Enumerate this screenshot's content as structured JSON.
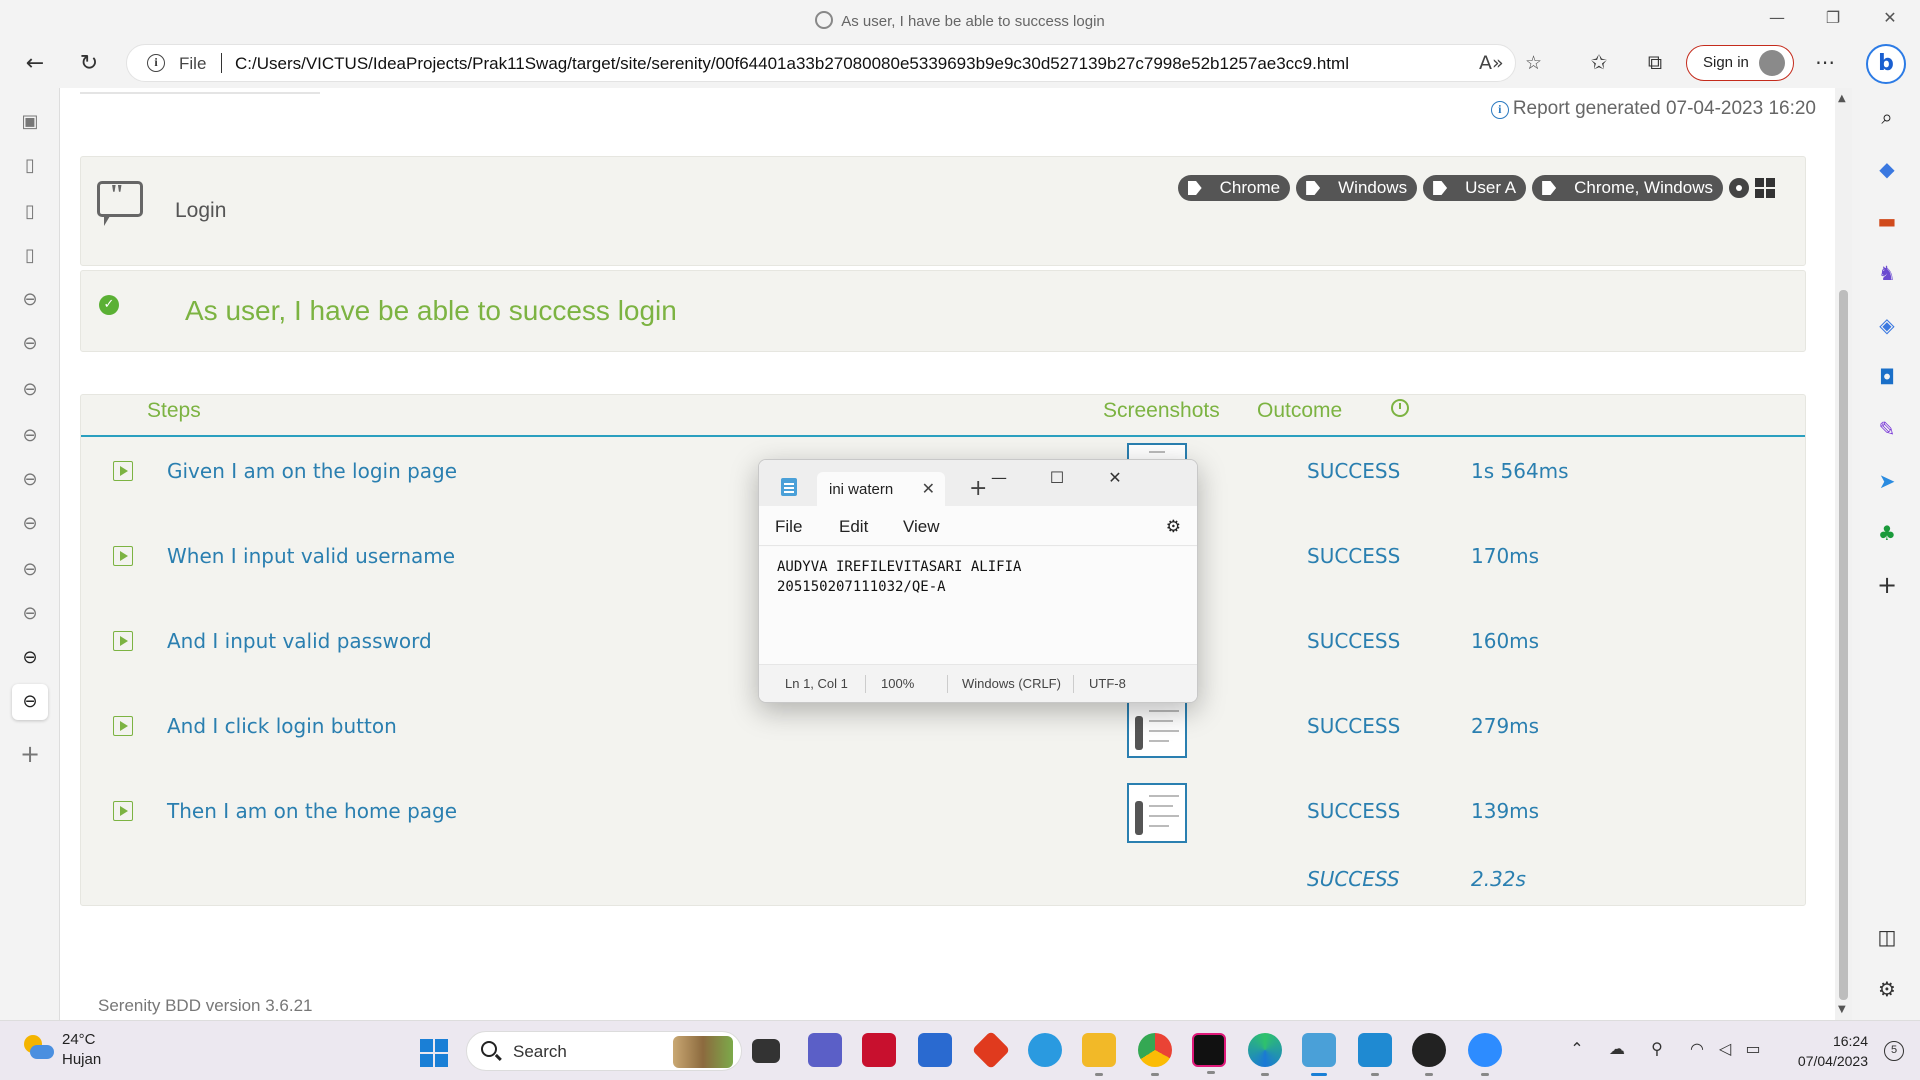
{
  "window": {
    "title": "As user, I have be able to success login"
  },
  "browser": {
    "address_scheme": "File",
    "url": "C:/Users/VICTUS/IdeaProjects/Prak11Swag/target/site/serenity/00f64401a33b27080080e5339693b9e9c30d527139b27c7998e52b1257ae3cc9.html",
    "sign_in_label": "Sign in"
  },
  "report": {
    "generated_label": "Report generated 07-04-2023 16:20",
    "feature_title": "Login",
    "tags": [
      "Chrome",
      "Windows",
      "User A",
      "Chrome, Windows"
    ],
    "scenario_title": "As user, I have be able to success login",
    "columns": {
      "steps": "Steps",
      "screenshots": "Screenshots",
      "outcome": "Outcome"
    },
    "steps": [
      {
        "text": "Given I am on the login page",
        "outcome": "SUCCESS",
        "duration": "1s 564ms"
      },
      {
        "text": "When I input valid username",
        "outcome": "SUCCESS",
        "duration": "170ms"
      },
      {
        "text": "And I input valid password",
        "outcome": "SUCCESS",
        "duration": "160ms"
      },
      {
        "text": "And I click login button",
        "outcome": "SUCCESS",
        "duration": "279ms"
      },
      {
        "text": "Then I am on the home page",
        "outcome": "SUCCESS",
        "duration": "139ms"
      }
    ],
    "total": {
      "outcome": "SUCCESS",
      "duration": "2.32s"
    },
    "footer": "Serenity BDD version 3.6.21"
  },
  "notepad": {
    "tab_title": "ini watern",
    "menu": [
      "File",
      "Edit",
      "View"
    ],
    "lines": [
      "AUDYVA IREFILEVITASARI ALIFIA",
      "205150207111032/QE-A"
    ],
    "status": {
      "position": "Ln 1, Col 1",
      "zoom": "100%",
      "line_ending": "Windows (CRLF)",
      "encoding": "UTF-8"
    }
  },
  "taskbar": {
    "temperature": "24°C",
    "condition": "Hujan",
    "search_label": "Search",
    "time": "16:24",
    "date": "07/04/2023",
    "notifications": "5"
  }
}
